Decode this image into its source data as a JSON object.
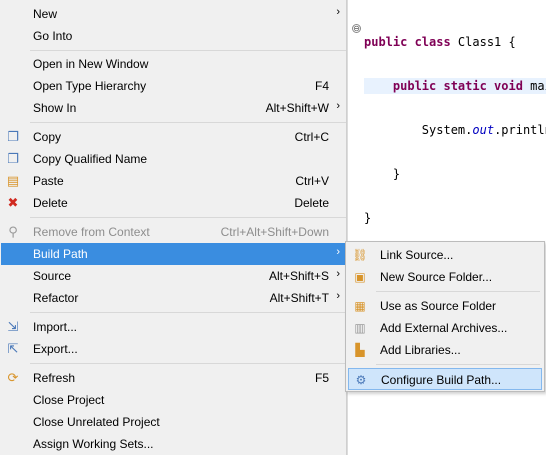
{
  "editor": {
    "fold_marker": "⊖",
    "lines": [
      {
        "tokens": [
          {
            "t": "public class ",
            "k": "kw"
          },
          {
            "t": "Class1 {",
            "k": ""
          }
        ]
      },
      {
        "tokens": [
          {
            "t": "    public static void ",
            "k": "kw"
          },
          {
            "t": "mai",
            "k": ""
          }
        ]
      },
      {
        "tokens": [
          {
            "t": "        System.",
            "k": ""
          },
          {
            "t": "out",
            "k": "fld"
          },
          {
            "t": ".println",
            "k": ""
          }
        ]
      },
      {
        "tokens": [
          {
            "t": "    }",
            "k": ""
          }
        ]
      },
      {
        "tokens": [
          {
            "t": "}",
            "k": ""
          }
        ]
      }
    ]
  },
  "menu": {
    "items": [
      {
        "label": "New",
        "accel": "",
        "submenu": true,
        "icon": "",
        "state": ""
      },
      {
        "label": "Go Into",
        "accel": "",
        "submenu": false,
        "icon": "",
        "state": ""
      },
      {
        "label": "Open in New Window",
        "accel": "",
        "submenu": false,
        "icon": "",
        "state": ""
      },
      {
        "label": "Open Type Hierarchy",
        "accel": "F4",
        "submenu": false,
        "icon": "",
        "state": ""
      },
      {
        "label": "Show In",
        "accel": "Alt+Shift+W",
        "submenu": true,
        "icon": "",
        "state": ""
      },
      {
        "label": "Copy",
        "accel": "Ctrl+C",
        "submenu": false,
        "icon": "copy-icon",
        "state": ""
      },
      {
        "label": "Copy Qualified Name",
        "accel": "",
        "submenu": false,
        "icon": "copy-qualified-icon",
        "state": ""
      },
      {
        "label": "Paste",
        "accel": "Ctrl+V",
        "submenu": false,
        "icon": "paste-icon",
        "state": ""
      },
      {
        "label": "Delete",
        "accel": "Delete",
        "submenu": false,
        "icon": "delete-icon",
        "state": ""
      },
      {
        "label": "Remove from Context",
        "accel": "Ctrl+Alt+Shift+Down",
        "submenu": false,
        "icon": "remove-context-icon",
        "state": "disabled"
      },
      {
        "label": "Build Path",
        "accel": "",
        "submenu": true,
        "icon": "",
        "state": "selected"
      },
      {
        "label": "Source",
        "accel": "Alt+Shift+S",
        "submenu": true,
        "icon": "",
        "state": ""
      },
      {
        "label": "Refactor",
        "accel": "Alt+Shift+T",
        "submenu": true,
        "icon": "",
        "state": ""
      },
      {
        "label": "Import...",
        "accel": "",
        "submenu": false,
        "icon": "import-icon",
        "state": ""
      },
      {
        "label": "Export...",
        "accel": "",
        "submenu": false,
        "icon": "export-icon",
        "state": ""
      },
      {
        "label": "Refresh",
        "accel": "F5",
        "submenu": false,
        "icon": "refresh-icon",
        "state": ""
      },
      {
        "label": "Close Project",
        "accel": "",
        "submenu": false,
        "icon": "",
        "state": ""
      },
      {
        "label": "Close Unrelated Project",
        "accel": "",
        "submenu": false,
        "icon": "",
        "state": ""
      },
      {
        "label": "Assign Working Sets...",
        "accel": "",
        "submenu": false,
        "icon": "",
        "state": ""
      }
    ],
    "submenu_arrow": "›"
  },
  "build_path_submenu": {
    "items": [
      {
        "label": "Link Source...",
        "icon": "link-source-icon",
        "state": ""
      },
      {
        "label": "New Source Folder...",
        "icon": "new-source-folder-icon",
        "state": ""
      },
      {
        "label": "Use as Source Folder",
        "icon": "use-source-folder-icon",
        "state": ""
      },
      {
        "label": "Add External Archives...",
        "icon": "add-external-archives-icon",
        "state": ""
      },
      {
        "label": "Add Libraries...",
        "icon": "add-libraries-icon",
        "state": ""
      },
      {
        "label": "Configure Build Path...",
        "icon": "configure-build-path-icon",
        "state": "selected"
      }
    ]
  },
  "colors": {
    "menu_bg": "#f0f0f0",
    "selection": "#3a8de0",
    "sub_selection": "#cfe5fb",
    "keyword": "#7f0055",
    "field": "#0000c0"
  }
}
